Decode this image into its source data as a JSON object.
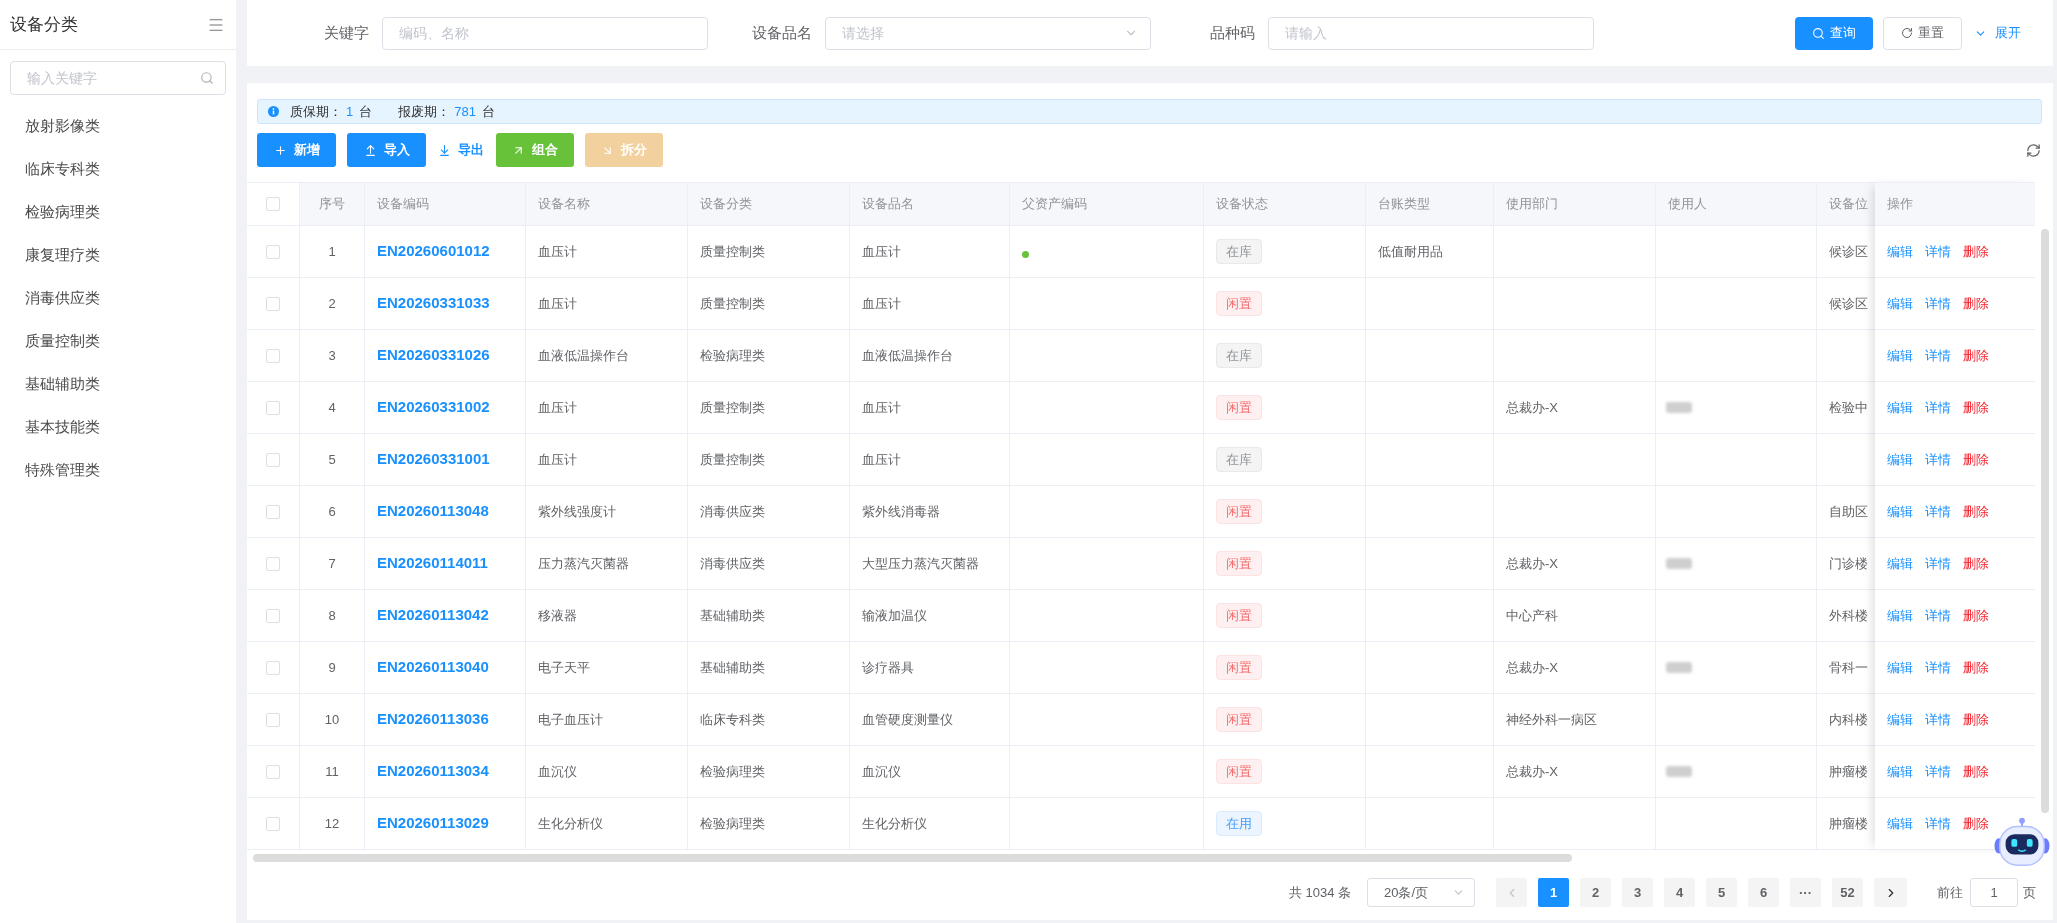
{
  "sidebar": {
    "title": "设备分类",
    "search": {
      "placeholder": "输入关键字"
    },
    "items": [
      {
        "label": "放射影像类"
      },
      {
        "label": "临床专科类"
      },
      {
        "label": "检验病理类"
      },
      {
        "label": "康复理疗类"
      },
      {
        "label": "消毒供应类"
      },
      {
        "label": "质量控制类"
      },
      {
        "label": "基础辅助类"
      },
      {
        "label": "基本技能类"
      },
      {
        "label": "特殊管理类"
      }
    ]
  },
  "filters": {
    "fields": [
      {
        "label": "关键字",
        "kind": "input",
        "placeholder": "编码、名称"
      },
      {
        "label": "设备品名",
        "kind": "select",
        "placeholder": "请选择"
      },
      {
        "label": "品种码",
        "kind": "input",
        "placeholder": "请输入"
      }
    ],
    "buttons": [
      {
        "label": "查询",
        "kind": "search"
      },
      {
        "label": "重置",
        "kind": "reset"
      },
      {
        "label": "展开",
        "kind": "expand"
      }
    ]
  },
  "summary": [
    {
      "label": "质保期：",
      "value": "1",
      "unit": "台"
    },
    {
      "label": "报废期：",
      "value": "781",
      "unit": "台"
    }
  ],
  "toolbar": [
    {
      "label": "新增",
      "kind": "add",
      "disabled": false
    },
    {
      "label": "导入",
      "kind": "import",
      "disabled": false
    },
    {
      "label": "导出",
      "kind": "export",
      "disabled": false
    },
    {
      "label": "组合",
      "kind": "combine",
      "disabled": false
    },
    {
      "label": "拆分",
      "kind": "split",
      "disabled": true
    }
  ],
  "table": {
    "header_checked": false,
    "columns": [
      "序号",
      "设备编码",
      "设备名称",
      "设备分类",
      "设备品名",
      "父资产编码",
      "设备状态",
      "台账类型",
      "使用部门",
      "使用人",
      "设备位",
      "操作"
    ],
    "rows": [
      {
        "index": "1",
        "checked": false,
        "code": "EN20260601012",
        "name": "血压计",
        "category": "质量控制类",
        "product": "血压计",
        "parent_dot": true,
        "status": {
          "label": "在库",
          "kind": "in_stock"
        },
        "ledger_type": "低值耐用品",
        "user_blurred": false,
        "location": "候诊区",
        "actions": [
          {
            "label": "编辑",
            "kind": "edit"
          },
          {
            "label": "详情",
            "kind": "detail"
          },
          {
            "label": "删除",
            "kind": "delete"
          }
        ]
      },
      {
        "index": "2",
        "checked": false,
        "code": "EN20260331033",
        "name": "血压计",
        "category": "质量控制类",
        "product": "血压计",
        "parent_dot": false,
        "status": {
          "label": "闲置",
          "kind": "idle"
        },
        "user_blurred": false,
        "location": "候诊区",
        "actions": [
          {
            "label": "编辑",
            "kind": "edit"
          },
          {
            "label": "详情",
            "kind": "detail"
          },
          {
            "label": "删除",
            "kind": "delete"
          }
        ]
      },
      {
        "index": "3",
        "checked": false,
        "code": "EN20260331026",
        "name": "血液低温操作台",
        "category": "检验病理类",
        "product": "血液低温操作台",
        "parent_dot": false,
        "status": {
          "label": "在库",
          "kind": "in_stock"
        },
        "user_blurred": false,
        "actions": [
          {
            "label": "编辑",
            "kind": "edit"
          },
          {
            "label": "详情",
            "kind": "detail"
          },
          {
            "label": "删除",
            "kind": "delete"
          }
        ]
      },
      {
        "index": "4",
        "checked": false,
        "code": "EN20260331002",
        "name": "血压计",
        "category": "质量控制类",
        "product": "血压计",
        "parent_dot": false,
        "status": {
          "label": "闲置",
          "kind": "idle"
        },
        "department": "总裁办-X",
        "user_blurred": true,
        "location": "检验中",
        "actions": [
          {
            "label": "编辑",
            "kind": "edit"
          },
          {
            "label": "详情",
            "kind": "detail"
          },
          {
            "label": "删除",
            "kind": "delete"
          }
        ]
      },
      {
        "index": "5",
        "checked": false,
        "code": "EN20260331001",
        "name": "血压计",
        "category": "质量控制类",
        "product": "血压计",
        "parent_dot": false,
        "status": {
          "label": "在库",
          "kind": "in_stock"
        },
        "user_blurred": false,
        "actions": [
          {
            "label": "编辑",
            "kind": "edit"
          },
          {
            "label": "详情",
            "kind": "detail"
          },
          {
            "label": "删除",
            "kind": "delete"
          }
        ]
      },
      {
        "index": "6",
        "checked": false,
        "code": "EN20260113048",
        "name": "紫外线强度计",
        "category": "消毒供应类",
        "product": "紫外线消毒器",
        "parent_dot": false,
        "status": {
          "label": "闲置",
          "kind": "idle"
        },
        "user_blurred": false,
        "location": "自助区",
        "actions": [
          {
            "label": "编辑",
            "kind": "edit"
          },
          {
            "label": "详情",
            "kind": "detail"
          },
          {
            "label": "删除",
            "kind": "delete"
          }
        ]
      },
      {
        "index": "7",
        "checked": false,
        "code": "EN20260114011",
        "name": "压力蒸汽灭菌器",
        "category": "消毒供应类",
        "product": "大型压力蒸汽灭菌器",
        "parent_dot": false,
        "status": {
          "label": "闲置",
          "kind": "idle"
        },
        "department": "总裁办-X",
        "user_blurred": true,
        "location": "门诊楼",
        "actions": [
          {
            "label": "编辑",
            "kind": "edit"
          },
          {
            "label": "详情",
            "kind": "detail"
          },
          {
            "label": "删除",
            "kind": "delete"
          }
        ]
      },
      {
        "index": "8",
        "checked": false,
        "code": "EN20260113042",
        "name": "移液器",
        "category": "基础辅助类",
        "product": "输液加温仪",
        "parent_dot": false,
        "status": {
          "label": "闲置",
          "kind": "idle"
        },
        "department": "中心产科",
        "user_blurred": false,
        "location": "外科楼",
        "actions": [
          {
            "label": "编辑",
            "kind": "edit"
          },
          {
            "label": "详情",
            "kind": "detail"
          },
          {
            "label": "删除",
            "kind": "delete"
          }
        ]
      },
      {
        "index": "9",
        "checked": false,
        "code": "EN20260113040",
        "name": "电子天平",
        "category": "基础辅助类",
        "product": "诊疗器具",
        "parent_dot": false,
        "status": {
          "label": "闲置",
          "kind": "idle"
        },
        "department": "总裁办-X",
        "user_blurred": true,
        "location": "骨科一",
        "actions": [
          {
            "label": "编辑",
            "kind": "edit"
          },
          {
            "label": "详情",
            "kind": "detail"
          },
          {
            "label": "删除",
            "kind": "delete"
          }
        ]
      },
      {
        "index": "10",
        "checked": false,
        "code": "EN20260113036",
        "name": "电子血压计",
        "category": "临床专科类",
        "product": "血管硬度测量仪",
        "parent_dot": false,
        "status": {
          "label": "闲置",
          "kind": "idle"
        },
        "department": "神经外科一病区",
        "user_blurred": false,
        "location": "内科楼",
        "actions": [
          {
            "label": "编辑",
            "kind": "edit"
          },
          {
            "label": "详情",
            "kind": "detail"
          },
          {
            "label": "删除",
            "kind": "delete"
          }
        ]
      },
      {
        "index": "11",
        "checked": false,
        "code": "EN20260113034",
        "name": "血沉仪",
        "category": "检验病理类",
        "product": "血沉仪",
        "parent_dot": false,
        "status": {
          "label": "闲置",
          "kind": "idle"
        },
        "department": "总裁办-X",
        "user_blurred": true,
        "location": "肿瘤楼",
        "actions": [
          {
            "label": "编辑",
            "kind": "edit"
          },
          {
            "label": "详情",
            "kind": "detail"
          },
          {
            "label": "删除",
            "kind": "delete"
          }
        ]
      },
      {
        "index": "12",
        "checked": false,
        "code": "EN20260113029",
        "name": "生化分析仪",
        "category": "检验病理类",
        "product": "生化分析仪",
        "parent_dot": false,
        "status": {
          "label": "在用",
          "kind": "in_use"
        },
        "user_blurred": false,
        "location": "肿瘤楼",
        "actions": [
          {
            "label": "编辑",
            "kind": "edit"
          },
          {
            "label": "详情",
            "kind": "detail"
          },
          {
            "label": "删除",
            "kind": "delete"
          }
        ]
      }
    ]
  },
  "pagination": {
    "total": "共 1034 条",
    "page_size": "20条/页",
    "prev_disabled": true,
    "next_disabled": false,
    "pages": [
      {
        "label": "1",
        "selected": true
      },
      {
        "label": "2",
        "selected": false
      },
      {
        "label": "3",
        "selected": false
      },
      {
        "label": "4",
        "selected": false
      },
      {
        "label": "5",
        "selected": false
      },
      {
        "label": "6",
        "selected": false
      },
      {
        "label": "···",
        "selected": false
      },
      {
        "label": "52",
        "selected": false
      }
    ],
    "goto": {
      "label": "前往",
      "value": "1",
      "unit": "页"
    }
  }
}
